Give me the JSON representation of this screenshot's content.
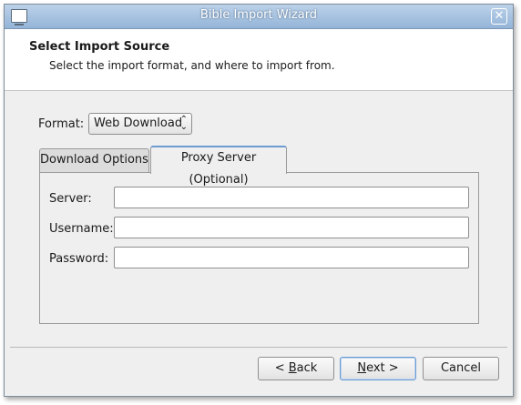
{
  "window": {
    "title": "Bible Import Wizard",
    "close_symbol": "✕"
  },
  "header": {
    "title": "Select Import Source",
    "subtitle": "Select the import format, and where to import from."
  },
  "format": {
    "label": "Format:",
    "selected": "Web Download",
    "arrows": "⌃⌄"
  },
  "tabs": [
    {
      "label": "Download Options",
      "active": false
    },
    {
      "label": "Proxy Server (Optional)",
      "active": true
    }
  ],
  "proxy": {
    "server_label": "Server:",
    "server_value": "",
    "username_label": "Username:",
    "username_value": "",
    "password_label": "Password:",
    "password_value": ""
  },
  "buttons": {
    "back_prefix": "< ",
    "back_mnemonic": "B",
    "back_rest": "ack",
    "next_mnemonic": "N",
    "next_rest": "ext >",
    "cancel": "Cancel"
  },
  "icons": [
    "window-app-icon",
    "close-icon",
    "select-arrows-icon"
  ],
  "colors": {
    "titlebar_top": "#bcd2e9",
    "titlebar_bottom": "#94b4d8",
    "active_tab_accent": "#6b9bd2",
    "dialog_bg": "#efefef"
  }
}
